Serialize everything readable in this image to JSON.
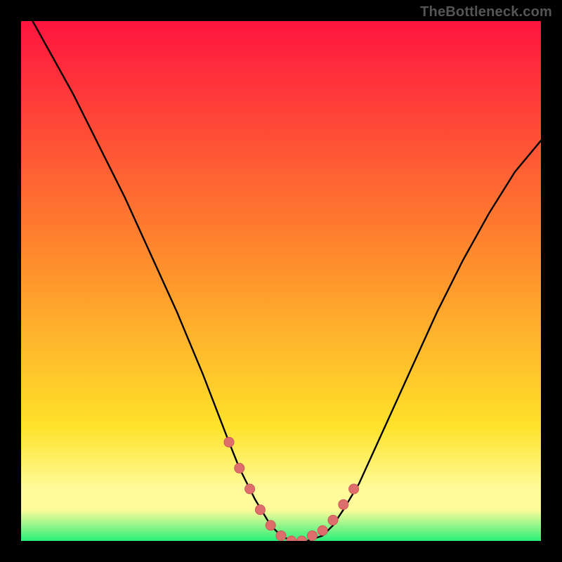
{
  "watermark": "TheBottleneck.com",
  "colors": {
    "frame": "#000000",
    "curve": "#000000",
    "marker_fill": "#de6e6c",
    "marker_stroke": "#cc5a58",
    "gradient_top": "#ff143f",
    "gradient_mid1": "#ff8a2d",
    "gradient_mid2": "#ffe22a",
    "gradient_band": "#fffb9a",
    "gradient_bottom": "#2af07a"
  },
  "chart_data": {
    "type": "line",
    "title": "",
    "xlabel": "",
    "ylabel": "",
    "xlim": [
      0,
      100
    ],
    "ylim": [
      0,
      100
    ],
    "grid": false,
    "legend": false,
    "annotations": [
      "TheBottleneck.com"
    ],
    "series": [
      {
        "name": "bottleneck-curve",
        "x": [
          0,
          5,
          10,
          15,
          20,
          25,
          30,
          35,
          40,
          42,
          45,
          48,
          50,
          52,
          55,
          58,
          60,
          62,
          65,
          70,
          75,
          80,
          85,
          90,
          95,
          100
        ],
        "y": [
          104,
          95,
          86,
          76,
          66,
          55,
          44,
          32,
          19,
          14,
          8,
          3,
          1,
          0,
          0,
          1,
          3,
          6,
          11,
          22,
          33,
          44,
          54,
          63,
          71,
          77
        ]
      }
    ],
    "markers": {
      "name": "highlight-points",
      "x": [
        40,
        42,
        44,
        46,
        48,
        50,
        52,
        54,
        56,
        58,
        60,
        62,
        64
      ],
      "y": [
        19,
        14,
        10,
        6,
        3,
        1,
        0,
        0,
        1,
        2,
        4,
        7,
        10
      ]
    }
  }
}
